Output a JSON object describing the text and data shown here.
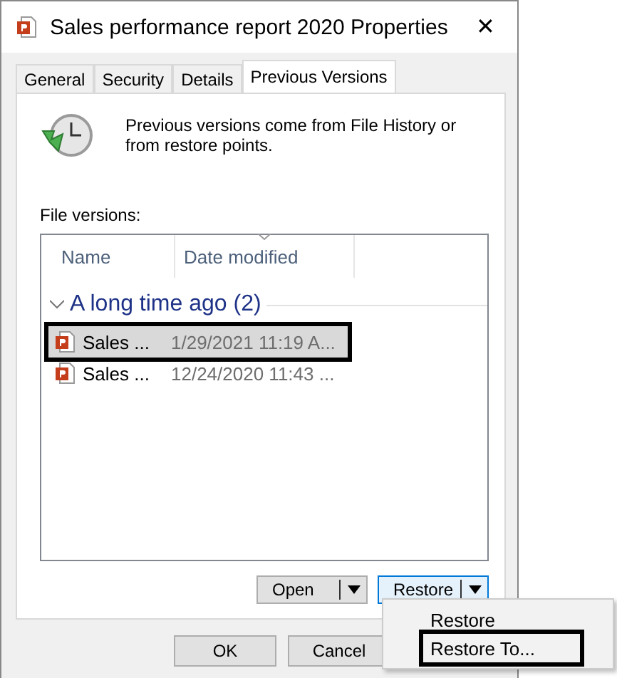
{
  "window": {
    "title": "Sales performance report 2020 Properties",
    "close": "✕"
  },
  "tabs": [
    {
      "label": "General",
      "selected": false
    },
    {
      "label": "Security",
      "selected": false
    },
    {
      "label": "Details",
      "selected": false
    },
    {
      "label": "Previous Versions",
      "selected": true
    }
  ],
  "info_text": "Previous versions come from File History or from restore points.",
  "file_versions_label": "File versions:",
  "table": {
    "columns": [
      "Name",
      "Date modified"
    ],
    "group": {
      "title": "A long time ago (2)",
      "expanded": true
    },
    "rows": [
      {
        "name": "Sales ...",
        "date": "1/29/2021 11:19 A...",
        "selected": true,
        "outlined": true
      },
      {
        "name": "Sales ...",
        "date": "12/24/2020 11:43 ...",
        "selected": false,
        "outlined": false
      }
    ]
  },
  "split_buttons": [
    {
      "label": "Open",
      "focused": false
    },
    {
      "label": "Restore",
      "focused": true
    }
  ],
  "dialog_buttons": [
    "OK",
    "Cancel"
  ],
  "menu": [
    {
      "label": "Restore",
      "outlined": false
    },
    {
      "label": "Restore To...",
      "outlined": true
    }
  ]
}
